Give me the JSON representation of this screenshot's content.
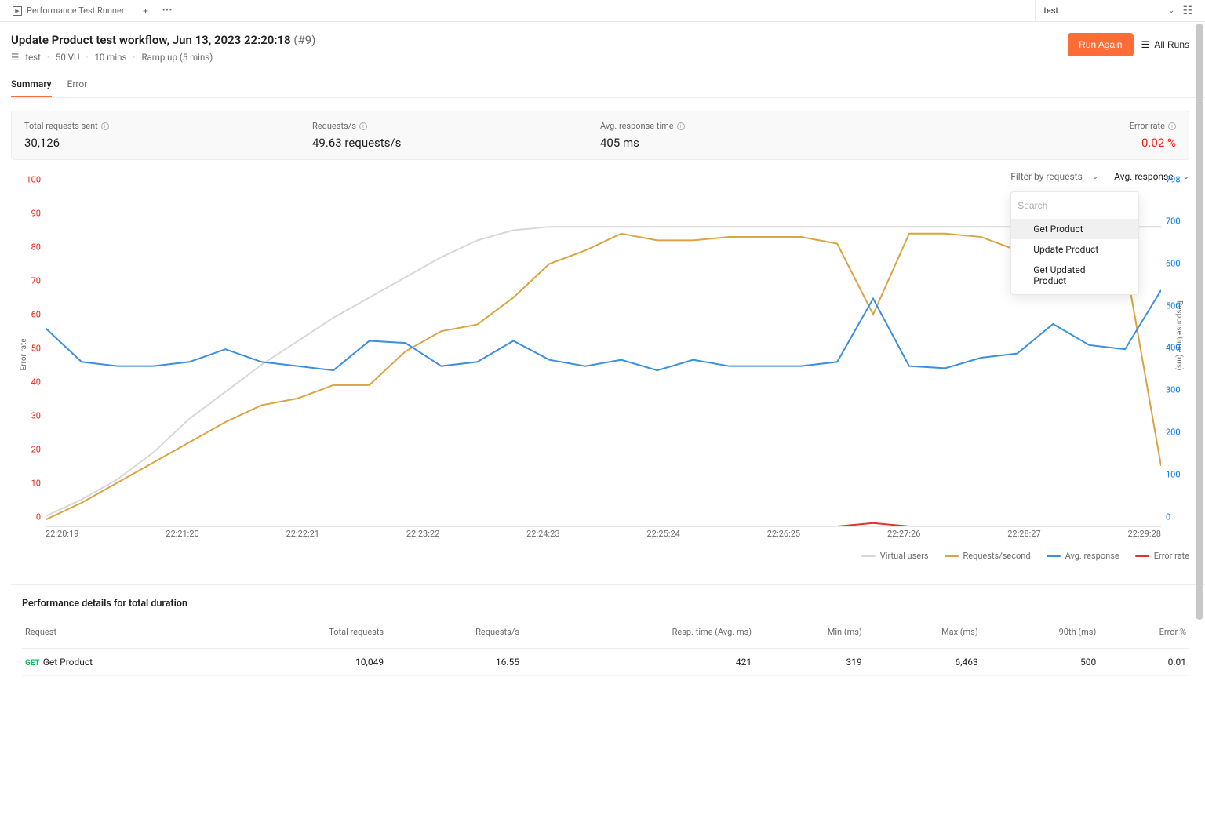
{
  "topbar": {
    "tab_title": "Performance Test Runner",
    "env_label": "test"
  },
  "header": {
    "title_main": "Update Product test workflow, Jun 13, 2023 22:20:18",
    "title_runnum": "(#9)",
    "sub_collection": "test",
    "sub_vu": "50 VU",
    "sub_duration": "10 mins",
    "sub_rampup": "Ramp up (5 mins)",
    "run_again": "Run Again",
    "all_runs": "All Runs"
  },
  "tabs": {
    "summary": "Summary",
    "error": "Error"
  },
  "metrics": {
    "total_label": "Total requests sent",
    "total_value": "30,126",
    "rps_label": "Requests/s",
    "rps_value": "49.63 requests/s",
    "avg_label": "Avg. response time",
    "avg_value": "405 ms",
    "err_label": "Error rate",
    "err_value": "0.02 %"
  },
  "chart_controls": {
    "filter_label": "Filter by requests",
    "metric_label": "Avg. response",
    "search_placeholder": "Search",
    "options": [
      "Get Product",
      "Update Product",
      "Get Updated Product"
    ]
  },
  "chart_data": {
    "type": "line",
    "x": [
      "22:20:19",
      "22:21:20",
      "22:22:21",
      "22:23:22",
      "22:24:23",
      "22:25:24",
      "22:26:25",
      "22:27:26",
      "22:28:27",
      "22:29:28"
    ],
    "y_left": {
      "label": "Error rate",
      "min": 0,
      "max": 100,
      "ticks": [
        0,
        10,
        20,
        30,
        40,
        50,
        60,
        70,
        80,
        90,
        100
      ]
    },
    "y_right": {
      "label": "Response time (ms)",
      "min": 0,
      "max": 798,
      "ticks": [
        0,
        100,
        200,
        300,
        400,
        500,
        600,
        700,
        798
      ]
    },
    "series": [
      {
        "name": "Virtual users",
        "color": "#d8d8d8",
        "axis": "left",
        "values": [
          3,
          8,
          14,
          22,
          32,
          40,
          48,
          55,
          62,
          68,
          74,
          80,
          85,
          88,
          89,
          89,
          89,
          89,
          89,
          89,
          89,
          89,
          89,
          89,
          89,
          89,
          89,
          89,
          89,
          89,
          89,
          89
        ]
      },
      {
        "name": "Requests/second",
        "color": "#d9a441",
        "axis": "left",
        "values": [
          2,
          7,
          13,
          19,
          25,
          31,
          36,
          38,
          42,
          42,
          52,
          58,
          60,
          68,
          78,
          82,
          87,
          85,
          85,
          86,
          86,
          86,
          84,
          63,
          87,
          87,
          86,
          82,
          80,
          80,
          79,
          18
        ]
      },
      {
        "name": "Avg. response",
        "color": "#3a8fde",
        "axis": "right",
        "values": [
          470,
          390,
          380,
          380,
          390,
          420,
          390,
          380,
          370,
          440,
          435,
          380,
          390,
          440,
          395,
          380,
          395,
          370,
          395,
          380,
          380,
          380,
          390,
          540,
          380,
          375,
          400,
          410,
          480,
          430,
          420,
          560
        ]
      },
      {
        "name": "Error rate",
        "color": "#e03131",
        "axis": "left",
        "values": [
          0,
          0,
          0,
          0,
          0,
          0,
          0,
          0,
          0,
          0,
          0,
          0,
          0,
          0,
          0,
          0,
          0,
          0,
          0,
          0,
          0,
          0,
          0,
          1,
          0,
          0,
          0,
          0,
          0,
          0,
          0,
          0
        ]
      }
    ]
  },
  "legend": {
    "vu": "Virtual users",
    "rps": "Requests/second",
    "avg": "Avg. response",
    "err": "Error rate"
  },
  "perf": {
    "title": "Performance details for total duration",
    "headers": [
      "Request",
      "Total requests",
      "Requests/s",
      "Resp. time (Avg. ms)",
      "Min (ms)",
      "Max (ms)",
      "90th (ms)",
      "Error %"
    ],
    "rows": [
      {
        "method": "GET",
        "name": "Get Product",
        "total": "10,049",
        "rps": "16.55",
        "avg": "421",
        "min": "319",
        "max": "6,463",
        "p90": "500",
        "err": "0.01"
      }
    ]
  }
}
